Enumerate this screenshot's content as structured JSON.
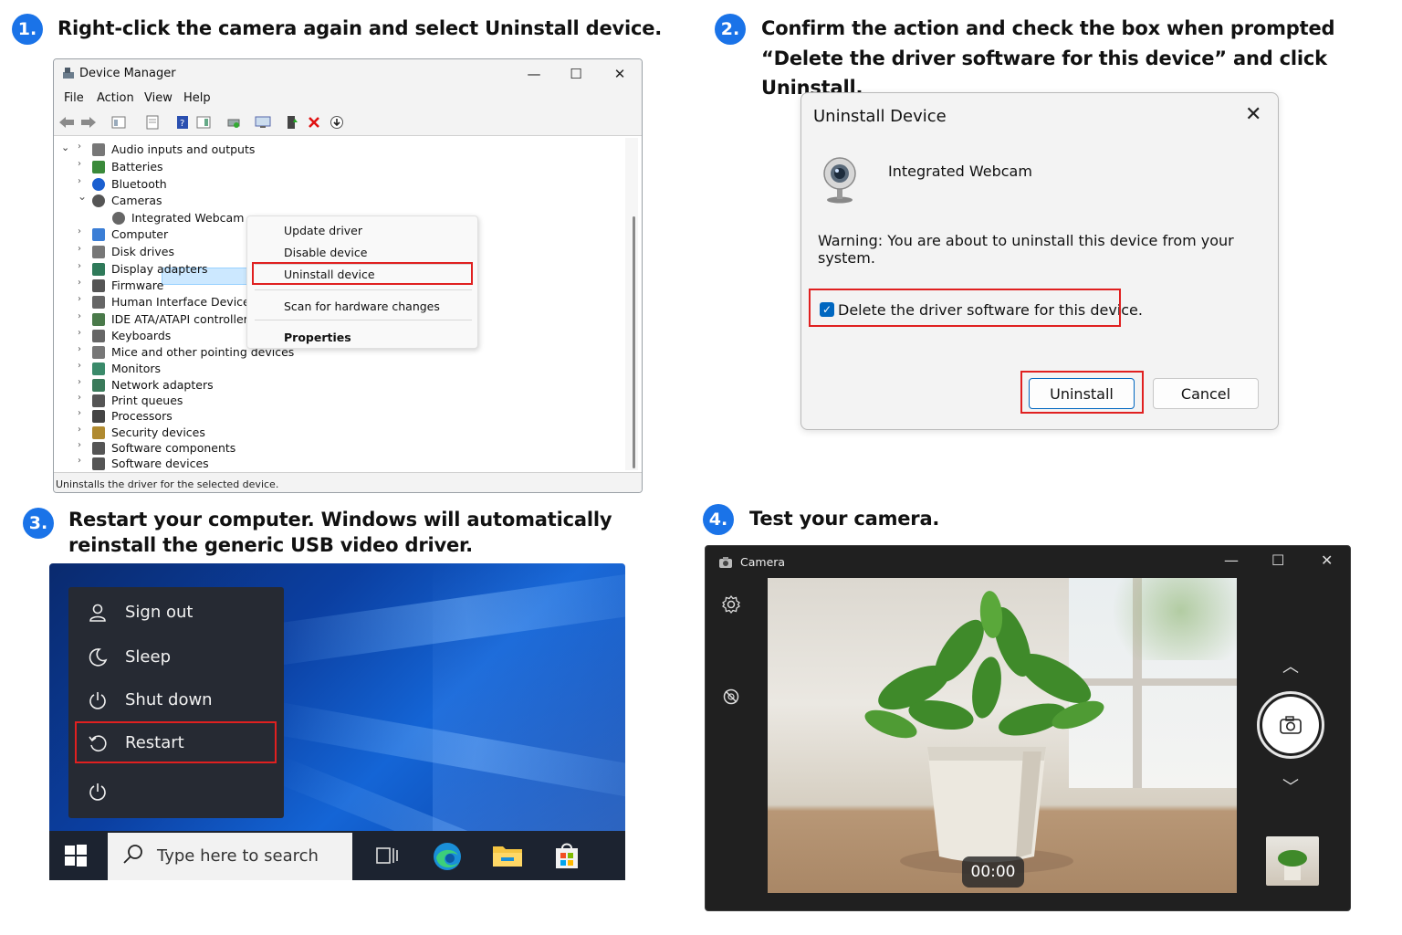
{
  "steps": [
    {
      "number": "1.",
      "text": "Right-click the camera again and select Uninstall device."
    },
    {
      "number": "2.",
      "line1": "Confirm the action and check the box when prompted",
      "line2": "“Delete the driver software for this device” and click Uninstall."
    },
    {
      "number": "3.",
      "line1": "Restart your computer. Windows will automatically",
      "line2": "reinstall the generic USB video driver."
    },
    {
      "number": "4.",
      "text": "Test your camera."
    }
  ],
  "device_manager": {
    "title": "Device Manager",
    "menu": [
      "File",
      "Action",
      "View",
      "Help"
    ],
    "tree": [
      {
        "label": "Audio inputs and outputs",
        "icon": "speaker-icon",
        "color": "#777777"
      },
      {
        "label": "Batteries",
        "icon": "battery-icon",
        "color": "#3a8a3a"
      },
      {
        "label": "Bluetooth",
        "icon": "bluetooth-icon",
        "color": "#1a5fd0"
      },
      {
        "label": "Cameras",
        "icon": "camera-icon",
        "color": "#555555"
      },
      {
        "label": "Integrated Webcam",
        "icon": "webcam-icon",
        "color": "#666666"
      },
      {
        "label": "Computer",
        "icon": "computer-icon",
        "color": "#3b7ed6"
      },
      {
        "label": "Disk drives",
        "icon": "disk-icon",
        "color": "#777777"
      },
      {
        "label": "Display adapters",
        "icon": "display-icon",
        "color": "#2f7a5a"
      },
      {
        "label": "Firmware",
        "icon": "firmware-icon",
        "color": "#555555"
      },
      {
        "label": "Human Interface Devices",
        "icon": "hid-icon",
        "color": "#666666"
      },
      {
        "label": "IDE ATA/ATAPI controllers",
        "icon": "ide-icon",
        "color": "#4a7a4a"
      },
      {
        "label": "Keyboards",
        "icon": "keyboard-icon",
        "color": "#666666"
      },
      {
        "label": "Mice and other pointing devices",
        "icon": "mouse-icon",
        "color": "#777777"
      },
      {
        "label": "Monitors",
        "icon": "monitor-icon",
        "color": "#3a8a6a"
      },
      {
        "label": "Network adapters",
        "icon": "network-icon",
        "color": "#3a7a5a"
      },
      {
        "label": "Print queues",
        "icon": "printer-icon",
        "color": "#555555"
      },
      {
        "label": "Processors",
        "icon": "cpu-icon",
        "color": "#444444"
      },
      {
        "label": "Security devices",
        "icon": "security-icon",
        "color": "#b08a30"
      },
      {
        "label": "Software components",
        "icon": "software-component-icon",
        "color": "#555555"
      },
      {
        "label": "Software devices",
        "icon": "software-device-icon",
        "color": "#555555"
      }
    ],
    "context_menu": {
      "update": "Update driver",
      "disable": "Disable device",
      "uninstall": "Uninstall device",
      "scan": "Scan for hardware changes",
      "properties": "Properties"
    },
    "status": "Uninstalls the driver for the selected device."
  },
  "dialog": {
    "title": "Uninstall Device",
    "device": "Integrated Webcam",
    "warning": "Warning: You are about to uninstall this device from your system.",
    "checkbox_label": "Delete the driver software for this device.",
    "uninstall_label": "Uninstall",
    "cancel_label": "Cancel"
  },
  "start_menu": {
    "sign_out": "Sign out",
    "sleep": "Sleep",
    "shut_down": "Shut down",
    "restart": "Restart",
    "search_placeholder": "Type here to search"
  },
  "camera": {
    "title": "Camera",
    "timer": "00:00"
  },
  "colors": {
    "accent": "#1a73e8",
    "highlight": "#e02020",
    "dialog_blue": "#0067c0"
  }
}
